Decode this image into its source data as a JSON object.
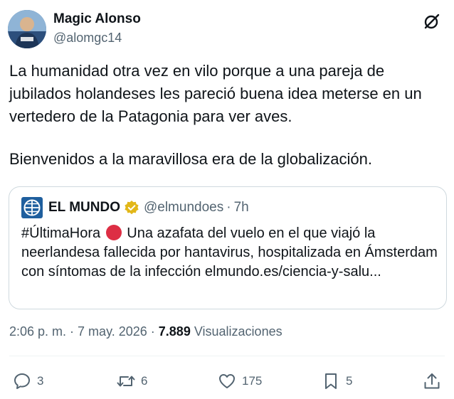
{
  "author": {
    "name": "Magic Alonso",
    "handle": "@alomgc14"
  },
  "tweet": {
    "paragraph1": "La humanidad otra vez en vilo porque a una pareja de jubilados holandeses les pareció buena idea meterse en un vertedero de la Patagonia para ver aves.",
    "paragraph2": "Bienvenidos a la maravillosa era de la globalización."
  },
  "quote": {
    "name": "EL MUNDO",
    "handle": "@elmundoes",
    "separator": "·",
    "time": "7h",
    "hashtag": "#ÚltimaHora",
    "text": "Una azafata del vuelo en el que viajó la neerlandesa fallecida por hantavirus, hospitalizada en Ámsterdam con síntomas de la infección elmundo.es/ciencia-y-salu..."
  },
  "meta": {
    "time": "2:06 p. m.",
    "dot1": "·",
    "date": "7 may. 2026",
    "dot2": "·",
    "views_count": "7.889",
    "views_label": "Visualizaciones"
  },
  "actions": {
    "replies": "3",
    "reposts": "6",
    "likes": "175",
    "bookmarks": "5"
  },
  "icons": {
    "grok": "grok-icon",
    "reply": "reply-icon",
    "repost": "repost-icon",
    "like": "heart-icon",
    "bookmark": "bookmark-icon",
    "share": "share-icon",
    "verified": "verified-badge-icon",
    "logo": "el-mundo-logo"
  },
  "colors": {
    "text": "#0f1419",
    "secondary": "#536471",
    "border": "#cfd9de",
    "verified_gold": "#e2b719",
    "logo_blue": "#1f5f9e",
    "red_circle": "#dd2e44"
  }
}
